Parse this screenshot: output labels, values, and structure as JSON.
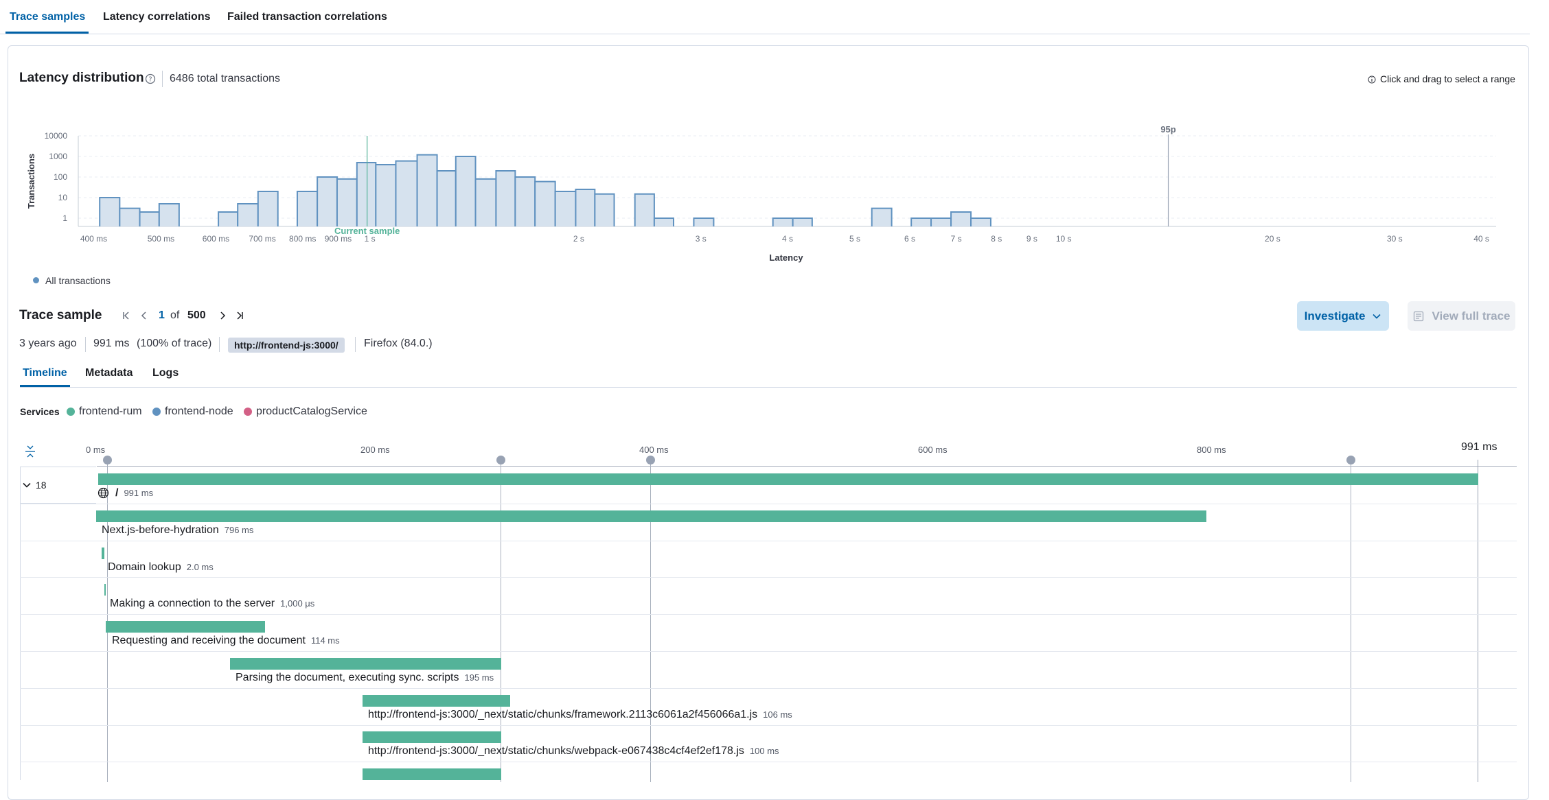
{
  "top_tabs": [
    "Trace samples",
    "Latency correlations",
    "Failed transaction correlations"
  ],
  "latency": {
    "title": "Latency distribution",
    "total": "6486 total transactions",
    "hint": "Click and drag to select a range",
    "legend": "All transactions"
  },
  "chart_data": {
    "type": "area",
    "xlabel": "Latency",
    "ylabel": "Transactions",
    "x_scale": "log",
    "y_scale": "log",
    "xlim": [
      "380 ms",
      "42 s"
    ],
    "ylim": [
      1,
      10000
    ],
    "y_ticks": [
      "1",
      "10",
      "100",
      "1000",
      "10000"
    ],
    "x_ticks": [
      "400 ms",
      "500 ms",
      "600 ms",
      "700 ms",
      "800 ms",
      "900 ms",
      "1 s",
      "2 s",
      "3 s",
      "4 s",
      "5 s",
      "6 s",
      "7 s",
      "8 s",
      "9 s",
      "10 s",
      "20 s",
      "30 s",
      "40 s"
    ],
    "annotations": [
      "Current sample",
      "95p"
    ],
    "grid": true,
    "series": [
      {
        "name": "All transactions",
        "color": "#6092c0",
        "bins": [
          {
            "x0": 0.408,
            "x1": 0.436,
            "count": 10
          },
          {
            "x0": 0.436,
            "x1": 0.466,
            "count": 3
          },
          {
            "x0": 0.466,
            "x1": 0.497,
            "count": 2
          },
          {
            "x0": 0.497,
            "x1": 0.531,
            "count": 5
          },
          {
            "x0": 0.531,
            "x1": 0.567,
            "count": 0
          },
          {
            "x0": 0.567,
            "x1": 0.605,
            "count": 0
          },
          {
            "x0": 0.605,
            "x1": 0.645,
            "count": 2
          },
          {
            "x0": 0.645,
            "x1": 0.69,
            "count": 5
          },
          {
            "x0": 0.69,
            "x1": 0.737,
            "count": 20
          },
          {
            "x0": 0.737,
            "x1": 0.786,
            "count": 0
          },
          {
            "x0": 0.786,
            "x1": 0.84,
            "count": 20
          },
          {
            "x0": 0.84,
            "x1": 0.897,
            "count": 100
          },
          {
            "x0": 0.897,
            "x1": 0.958,
            "count": 80
          },
          {
            "x0": 0.958,
            "x1": 1.02,
            "count": 500
          },
          {
            "x0": 1.02,
            "x1": 1.09,
            "count": 400
          },
          {
            "x0": 1.09,
            "x1": 1.17,
            "count": 600
          },
          {
            "x0": 1.17,
            "x1": 1.25,
            "count": 1200
          },
          {
            "x0": 1.25,
            "x1": 1.33,
            "count": 200
          },
          {
            "x0": 1.33,
            "x1": 1.42,
            "count": 1000
          },
          {
            "x0": 1.42,
            "x1": 1.52,
            "count": 80
          },
          {
            "x0": 1.52,
            "x1": 1.62,
            "count": 200
          },
          {
            "x0": 1.62,
            "x1": 1.73,
            "count": 100
          },
          {
            "x0": 1.73,
            "x1": 1.85,
            "count": 60
          },
          {
            "x0": 1.85,
            "x1": 1.98,
            "count": 20
          },
          {
            "x0": 1.98,
            "x1": 2.11,
            "count": 25
          },
          {
            "x0": 2.11,
            "x1": 2.25,
            "count": 15
          },
          {
            "x0": 2.25,
            "x1": 2.41,
            "count": 0
          },
          {
            "x0": 2.41,
            "x1": 2.57,
            "count": 15
          },
          {
            "x0": 2.57,
            "x1": 2.74,
            "count": 1
          },
          {
            "x0": 2.74,
            "x1": 2.93,
            "count": 0
          },
          {
            "x0": 2.93,
            "x1": 3.13,
            "count": 1
          },
          {
            "x0": 3.13,
            "x1": 3.34,
            "count": 0
          },
          {
            "x0": 3.34,
            "x1": 3.57,
            "count": 0
          },
          {
            "x0": 3.57,
            "x1": 3.81,
            "count": 0
          },
          {
            "x0": 3.81,
            "x1": 4.07,
            "count": 1
          },
          {
            "x0": 4.07,
            "x1": 4.34,
            "count": 1
          },
          {
            "x0": 4.34,
            "x1": 4.64,
            "count": 0
          },
          {
            "x0": 4.64,
            "x1": 4.95,
            "count": 0
          },
          {
            "x0": 4.95,
            "x1": 5.29,
            "count": 0
          },
          {
            "x0": 5.29,
            "x1": 5.65,
            "count": 3
          },
          {
            "x0": 5.65,
            "x1": 6.03,
            "count": 0
          },
          {
            "x0": 6.03,
            "x1": 6.44,
            "count": 1
          },
          {
            "x0": 6.44,
            "x1": 6.88,
            "count": 1
          },
          {
            "x0": 6.88,
            "x1": 7.35,
            "count": 2
          },
          {
            "x0": 7.35,
            "x1": 7.85,
            "count": 1
          },
          {
            "x0": 7.85,
            "x1": 8.38,
            "count": 0
          },
          {
            "x0": 8.38,
            "x1": 8.95,
            "count": 0
          },
          {
            "x0": 8.95,
            "x1": 9.56,
            "count": 0
          },
          {
            "x0": 9.56,
            "x1": 10.2,
            "count": 0
          },
          {
            "x0": 10.2,
            "x1": 10.9,
            "count": 0
          },
          {
            "x0": 10.9,
            "x1": 11.6,
            "count": 0
          },
          {
            "x0": 11.6,
            "x1": 12.4,
            "count": 0
          },
          {
            "x0": 12.4,
            "x1": 13.3,
            "count": 0
          },
          {
            "x0": 13.3,
            "x1": 14.2,
            "count": 0
          },
          {
            "x0": 14.2,
            "x1": 15.1,
            "count": 0
          },
          {
            "x0": 15.1,
            "x1": 16.2,
            "count": 0
          },
          {
            "x0": 16.2,
            "x1": 17.3,
            "count": 0
          },
          {
            "x0": 17.3,
            "x1": 18.5,
            "count": 0
          },
          {
            "x0": 18.5,
            "x1": 19.7,
            "count": 0
          },
          {
            "x0": 19.7,
            "x1": 21.1,
            "count": 0
          },
          {
            "x0": 21.1,
            "x1": 22.5,
            "count": 0
          },
          {
            "x0": 22.5,
            "x1": 24.0,
            "count": 0
          },
          {
            "x0": 24.0,
            "x1": 25.7,
            "count": 0
          },
          {
            "x0": 25.7,
            "x1": 27.4,
            "count": 0
          },
          {
            "x0": 27.4,
            "x1": 29.3,
            "count": 0
          },
          {
            "x0": 29.3,
            "x1": 31.3,
            "count": 0
          },
          {
            "x0": 31.3,
            "x1": 33.4,
            "count": 0
          },
          {
            "x0": 33.4,
            "x1": 35.7,
            "count": 0
          }
        ]
      }
    ]
  },
  "sample": {
    "title": "Trace sample",
    "page": "1",
    "of": "of",
    "total": "500",
    "ago": "3 years ago",
    "duration": "991 ms",
    "percent": "(100% of trace)",
    "url": "http://frontend-js:3000/",
    "browser": "Firefox (84.0.)",
    "investigate": "Investigate",
    "view_full_trace": "View full trace"
  },
  "sub_tabs": [
    "Timeline",
    "Metadata",
    "Logs"
  ],
  "services": {
    "label": "Services",
    "items": [
      {
        "name": "frontend-rum",
        "color": "#54b399"
      },
      {
        "name": "frontend-node",
        "color": "#6092c0"
      },
      {
        "name": "productCatalogService",
        "color": "#d36086"
      }
    ]
  },
  "timeline": {
    "ticks": [
      "0 ms",
      "200 ms",
      "400 ms",
      "600 ms",
      "800 ms"
    ],
    "end_label": "991 ms",
    "group_count": "18",
    "total_ms": 991,
    "rows": [
      {
        "name": "/",
        "duration": "991 ms",
        "start_ms": 0,
        "dur_ms": 991
      },
      {
        "name": "Next.js-before-hydration",
        "duration": "796 ms",
        "start_ms": -2,
        "dur_ms": 796
      },
      {
        "name": "Domain lookup",
        "duration": "2.0 ms",
        "start_ms": 2,
        "dur_ms": 2
      },
      {
        "name": "Making a connection to the server",
        "duration": "1,000 μs",
        "start_ms": 4.5,
        "dur_ms": 1
      },
      {
        "name": "Requesting and receiving the document",
        "duration": "114 ms",
        "start_ms": 6,
        "dur_ms": 114
      },
      {
        "name": "Parsing the document, executing sync. scripts",
        "duration": "195 ms",
        "start_ms": 95,
        "dur_ms": 195
      },
      {
        "name": "http://frontend-js:3000/_next/static/chunks/framework.2113c6061a2f456066a1.js",
        "duration": "106 ms",
        "start_ms": 190,
        "dur_ms": 106
      },
      {
        "name": "http://frontend-js:3000/_next/static/chunks/webpack-e067438c4cf4ef2ef178.js",
        "duration": "100 ms",
        "start_ms": 190,
        "dur_ms": 100
      },
      {
        "name": "",
        "duration": "",
        "start_ms": 190,
        "dur_ms": 100
      }
    ]
  }
}
